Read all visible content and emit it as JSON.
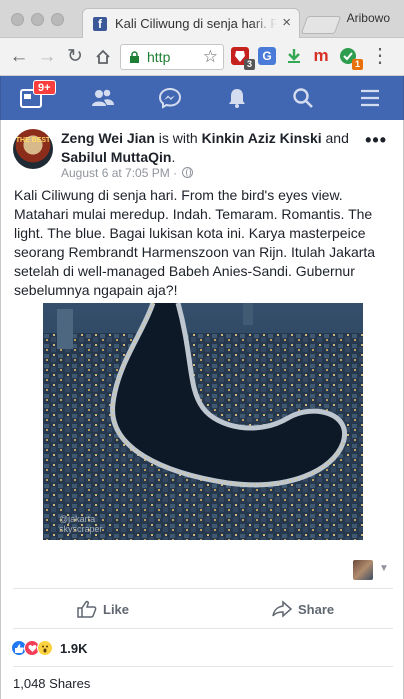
{
  "browser": {
    "tab_title": "Kali Ciliwung di senja hari. Fr",
    "tab_close": "×",
    "profile_name": "Aribowo",
    "url": "http",
    "extensions": [
      {
        "name": "extension-red",
        "badge": "3",
        "color": "#c5221f"
      },
      {
        "name": "extension-translate",
        "badge": "",
        "color": "#4a7bd8"
      },
      {
        "name": "extension-download",
        "badge": "",
        "color": "#34a853"
      },
      {
        "name": "extension-m",
        "badge": "",
        "color": "#d93025"
      },
      {
        "name": "extension-green",
        "badge": "1",
        "color": "#2e9d4f"
      }
    ]
  },
  "fb": {
    "notification_count": "9+",
    "brand_color": "#4267b2"
  },
  "post": {
    "author": "Zeng Wei Jian",
    "with_text": " is with ",
    "tagged_1": "Kinkin Aziz Kinski",
    "and_text": " and ",
    "tagged_2": "Sabilul MuttaQin",
    "period": ".",
    "timestamp": "August 6 at 7:05 PM",
    "meta_sep": " · ",
    "avatar_text": "THE BEST",
    "body": "Kali Ciliwung di senja hari. From the bird's eyes view. Matahari mulai meredup. Indah. Temaram. Romantis. The light. The blue. Bagai lukisan kota ini. Karya masterpeice seorang Rembrandt Harmenszoon van Rijn. Itulah Jakarta setelah di well-managed Babeh Anies-Sandi. Gubernur sebelumnya ngapain aja?!",
    "photo_watermark_1": "@jakarta",
    "photo_watermark_2": "skyscraper",
    "more_label": "•••",
    "like_label": "Like",
    "share_label": "Share",
    "reaction_count": "1.9K",
    "shares": "1,048 Shares"
  }
}
